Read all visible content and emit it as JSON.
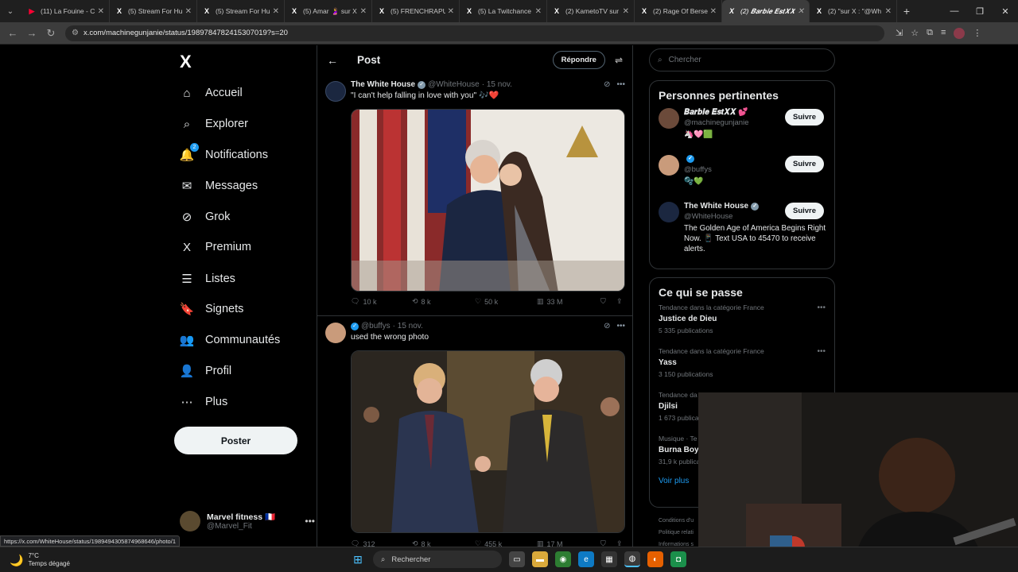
{
  "browser": {
    "tabs": [
      {
        "icon": "youtube-icon",
        "glyph": "▶",
        "title": "(11) La Fouine - C",
        "active": false,
        "yt": true
      },
      {
        "icon": "x-logo-icon",
        "glyph": "X",
        "title": "(5) Stream For Hu",
        "active": false
      },
      {
        "icon": "x-logo-icon",
        "glyph": "X",
        "title": "(5) Stream For Hu",
        "active": false
      },
      {
        "icon": "x-logo-icon",
        "glyph": "X",
        "title": "(5) Amar 🤰 sur X",
        "active": false
      },
      {
        "icon": "x-logo-icon",
        "glyph": "X",
        "title": "(5) FRENCHRAPU",
        "active": false
      },
      {
        "icon": "x-logo-icon",
        "glyph": "X",
        "title": "(5) La Twitchance",
        "active": false
      },
      {
        "icon": "x-logo-icon",
        "glyph": "X",
        "title": "(2) KametoTV sur",
        "active": false
      },
      {
        "icon": "x-logo-icon",
        "glyph": "X",
        "title": "(2) Rage Of Berse",
        "active": false
      },
      {
        "icon": "x-logo-icon",
        "glyph": "X",
        "title": "(2) 𝑩𝒂𝒓𝒃𝒊𝒆 𝑬𝒔𝒕𝑿𝑿",
        "active": true
      },
      {
        "icon": "x-logo-icon",
        "glyph": "X",
        "title": "(2) \"sur X : \"@Wh",
        "active": false
      }
    ],
    "url": "x.com/machinegunjanie/status/1989784782415307019?s=20",
    "status_link": "https://x.com/WhiteHouse/status/1989494305874968646/photo/1"
  },
  "nav": {
    "logo": "X",
    "badge": "2",
    "items": [
      {
        "id": "home",
        "label": "Accueil",
        "icon": "home-icon",
        "glyph": "⌂"
      },
      {
        "id": "explore",
        "label": "Explorer",
        "icon": "search-icon",
        "glyph": "⌕"
      },
      {
        "id": "notifications",
        "label": "Notifications",
        "icon": "bell-icon",
        "glyph": "🔔"
      },
      {
        "id": "messages",
        "label": "Messages",
        "icon": "mail-icon",
        "glyph": "✉"
      },
      {
        "id": "grok",
        "label": "Grok",
        "icon": "grok-icon",
        "glyph": "⊘"
      },
      {
        "id": "premium",
        "label": "Premium",
        "icon": "x-premium-icon",
        "glyph": "X"
      },
      {
        "id": "lists",
        "label": "Listes",
        "icon": "list-icon",
        "glyph": "☰"
      },
      {
        "id": "bookmarks",
        "label": "Signets",
        "icon": "bookmark-icon",
        "glyph": "🔖"
      },
      {
        "id": "communities",
        "label": "Communautés",
        "icon": "people-icon",
        "glyph": "👥"
      },
      {
        "id": "profile",
        "label": "Profil",
        "icon": "person-icon",
        "glyph": "👤"
      },
      {
        "id": "more",
        "label": "Plus",
        "icon": "more-circle-icon",
        "glyph": "⋯"
      }
    ],
    "post_button": "Poster",
    "account": {
      "name": "Marvel fitness 🇫🇷",
      "handle": "@Marvel_Fit"
    }
  },
  "main": {
    "title": "Post",
    "reply_button": "Répondre",
    "tweets": [
      {
        "name": "The White House",
        "handle": "@WhiteHouse",
        "date": "· 15 nov.",
        "text": "\"I can't help falling in love with you\" 🎶❤️",
        "stats": {
          "replies": "10 k",
          "retweets": "8 k",
          "likes": "50 k",
          "views": "33 M"
        }
      },
      {
        "name": "",
        "handle": "@buffys",
        "date": "· 15 nov.",
        "text": "used the wrong photo",
        "stats": {
          "replies": "312",
          "retweets": "8 k",
          "likes": "455 k",
          "views": "17 M"
        }
      }
    ]
  },
  "right": {
    "search_placeholder": "Chercher",
    "relevant_title": "Personnes pertinentes",
    "people": [
      {
        "name": "𝑩𝒂𝒓𝒃𝒊𝒆 𝑬𝒔𝒕𝑿𝑿 💕",
        "handle": "@machinegunjanie",
        "bio": "🦄🩷🟩",
        "follow": "Suivre",
        "verified": false
      },
      {
        "name": "",
        "handle": "@buffys",
        "bio": "🫧💚",
        "follow": "Suivre",
        "verified": true
      },
      {
        "name": "The White House",
        "handle": "@WhiteHouse",
        "bio": "The Golden Age of America Begins Right Now. 📱 Text USA to 45470 to receive alerts.",
        "follow": "Suivre",
        "verified": true
      }
    ],
    "trends_title": "Ce qui se passe",
    "trends": [
      {
        "category": "Tendance dans la catégorie France",
        "title": "Justice de Dieu",
        "count": "5 335 publications"
      },
      {
        "category": "Tendance dans la catégorie France",
        "title": "Yass",
        "count": "3 150 publications"
      },
      {
        "category": "Tendance da",
        "title": "Djilsi",
        "count": "1 673 publications"
      },
      {
        "category": "Musique · Te",
        "title": "Burna Boy",
        "count": "31,9 k publica"
      }
    ],
    "see_more": "Voir plus",
    "footer": [
      "Conditions d'u",
      "Politique relati",
      "Informations s"
    ]
  },
  "taskbar": {
    "temp": "7°C",
    "weather": "Temps dégagé",
    "search": "Rechercher"
  },
  "colors": {
    "accent": "#1d9bf0",
    "bg": "#000000",
    "border": "#2f3336",
    "muted": "#71767b"
  }
}
